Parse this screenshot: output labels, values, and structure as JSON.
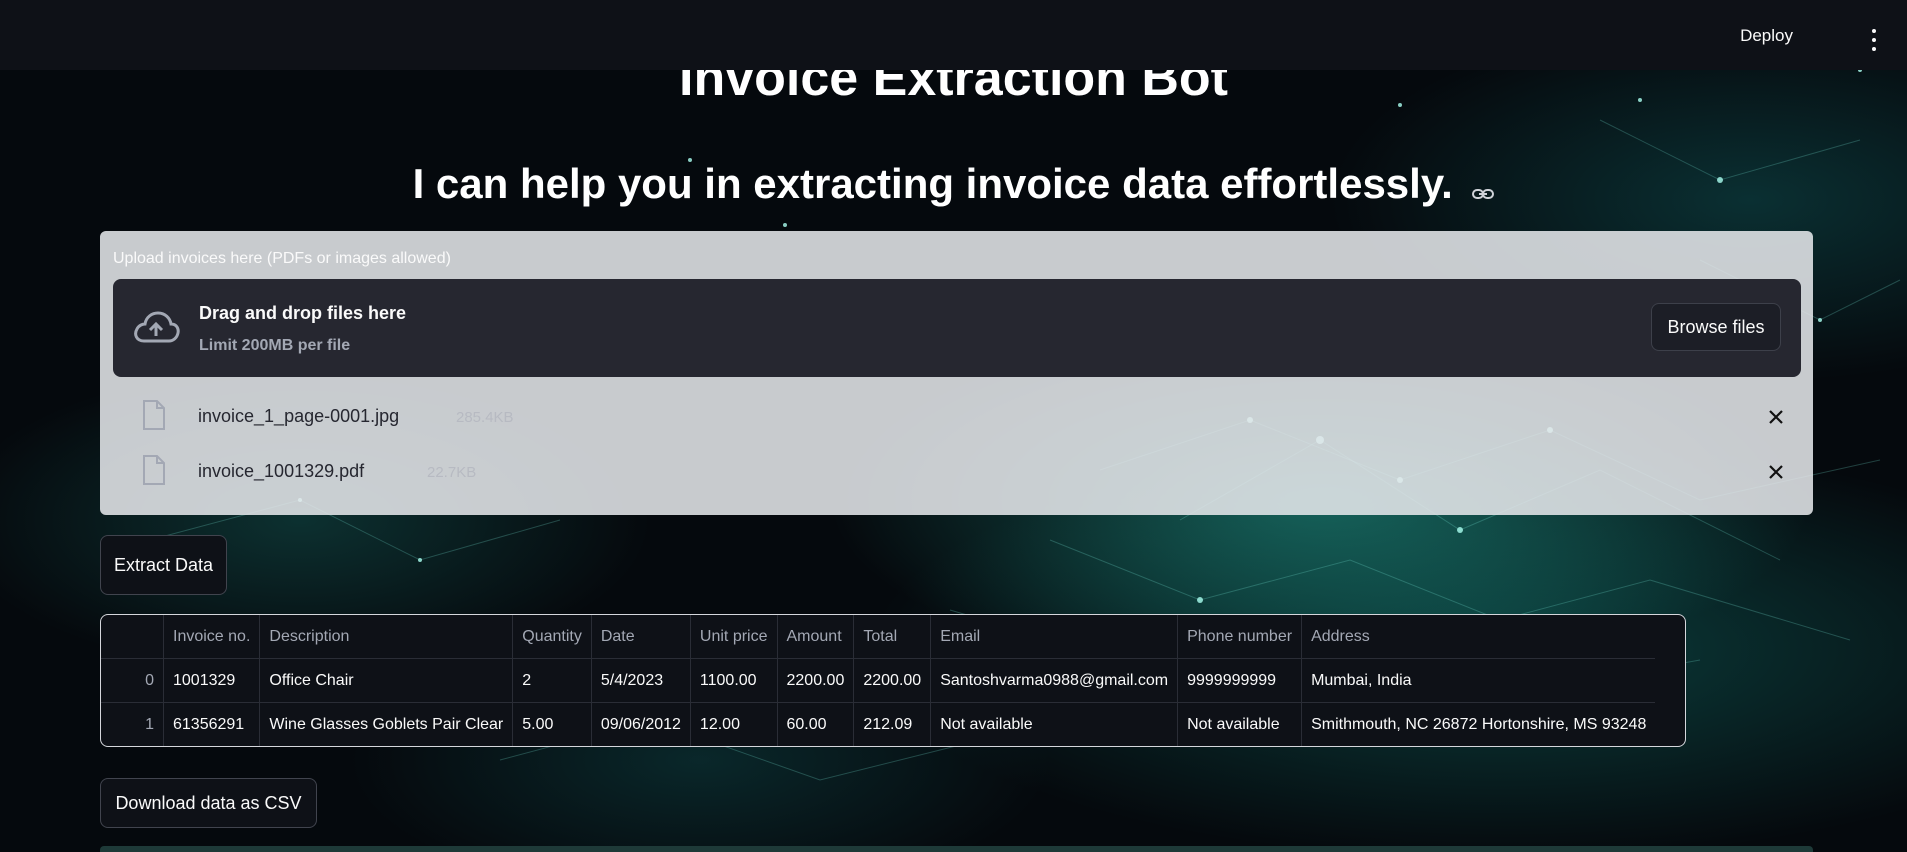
{
  "topbar": {
    "deploy_label": "Deploy",
    "menu_icon": "kebab-menu-icon"
  },
  "header": {
    "title": "Invoice Extraction Bot",
    "subtitle": "I can help you in extracting invoice data effortlessly.",
    "anchor_icon": "link-icon"
  },
  "uploader": {
    "label": "Upload invoices here (PDFs or images allowed)",
    "drop_title": "Drag and drop files here",
    "drop_limit": "Limit 200MB per file",
    "browse_label": "Browse files",
    "files": [
      {
        "name": "invoice_1_page-0001.jpg",
        "size": "285.4KB"
      },
      {
        "name": "invoice_1001329.pdf",
        "size": "22.7KB"
      }
    ]
  },
  "actions": {
    "extract_label": "Extract Data",
    "download_label": "Download data as CSV"
  },
  "table": {
    "columns": [
      "",
      "Invoice no.",
      "Description",
      "Quantity",
      "Date",
      "Unit price",
      "Amount",
      "Total",
      "Email",
      "Phone number",
      "Address"
    ],
    "rows": [
      [
        "0",
        "1001329",
        "Office Chair",
        "2",
        "5/4/2023",
        "1100.00",
        "2200.00",
        "2200.00",
        "Santoshvarma0988@gmail.com",
        "9999999999",
        "Mumbai, India"
      ],
      [
        "1",
        "61356291",
        "Wine Glasses Goblets Pair Clear",
        "5.00",
        "09/06/2012",
        "12.00",
        "60.00",
        "212.09",
        "Not available",
        "Not available",
        "Smithmouth, NC 26872 Hortonshire, MS 93248"
      ]
    ]
  },
  "colors": {
    "topbar": "#0e1117",
    "accent_teal": "#2bb5a5",
    "dropzone": "#262730"
  }
}
